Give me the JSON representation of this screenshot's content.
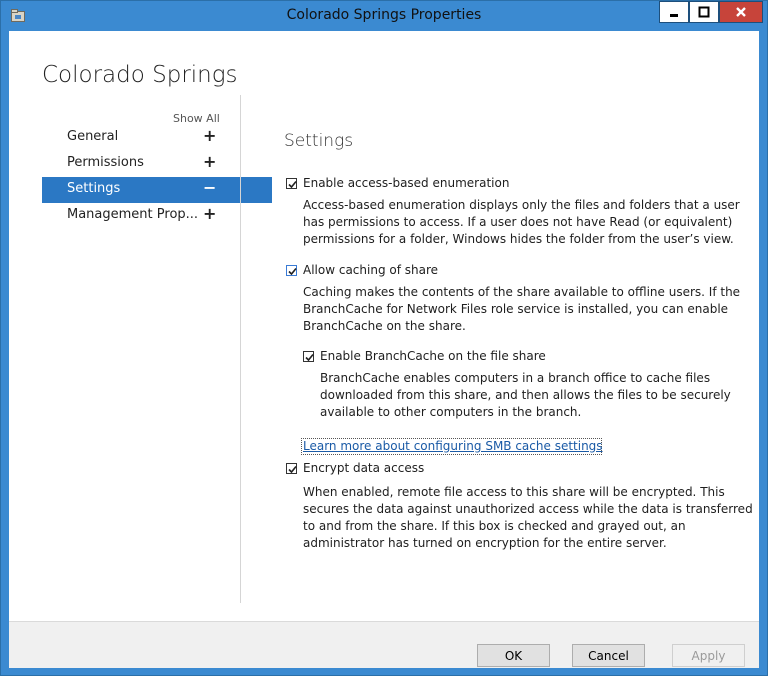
{
  "window": {
    "title": "Colorado Springs Properties"
  },
  "page": {
    "heading": "Colorado Springs",
    "show_all": "Show All"
  },
  "nav": [
    {
      "label": "General",
      "symbol": "+"
    },
    {
      "label": "Permissions",
      "symbol": "+"
    },
    {
      "label": "Settings",
      "symbol": "−",
      "active": true
    },
    {
      "label": "Management Prop...",
      "symbol": "+"
    }
  ],
  "settings": {
    "title": "Settings",
    "abe_label": "Enable access-based enumeration",
    "abe_desc1": "Access-based enumeration displays only the files and folders that a user",
    "abe_desc2": "has permissions to access. If a user does not have Read (or equivalent)",
    "abe_desc3": "permissions for a folder, Windows hides the folder from the user’s view.",
    "cache_label": "Allow caching of share",
    "cache_desc1": "Caching makes the contents of the share available to offline users. If the",
    "cache_desc2": "BranchCache for Network Files role service is installed, you can enable",
    "cache_desc3": "BranchCache on the share.",
    "bc_label": "Enable BranchCache on the file share",
    "bc_desc1": "BranchCache enables computers in a branch office to cache files",
    "bc_desc2": "downloaded from this share, and then allows the files to be securely",
    "bc_desc3": "available to other computers in the branch.",
    "link": "Learn more about configuring SMB cache settings",
    "enc_label": "Encrypt data access",
    "enc_desc1": "When enabled, remote file access to this share will be encrypted. This",
    "enc_desc2": "secures the data against unauthorized access while the data is transferred",
    "enc_desc3": "to and from the share. If this box is checked and grayed out, an",
    "enc_desc4": "administrator has turned on encryption for the entire server."
  },
  "footer": {
    "ok": "OK",
    "cancel": "Cancel",
    "apply": "Apply"
  }
}
